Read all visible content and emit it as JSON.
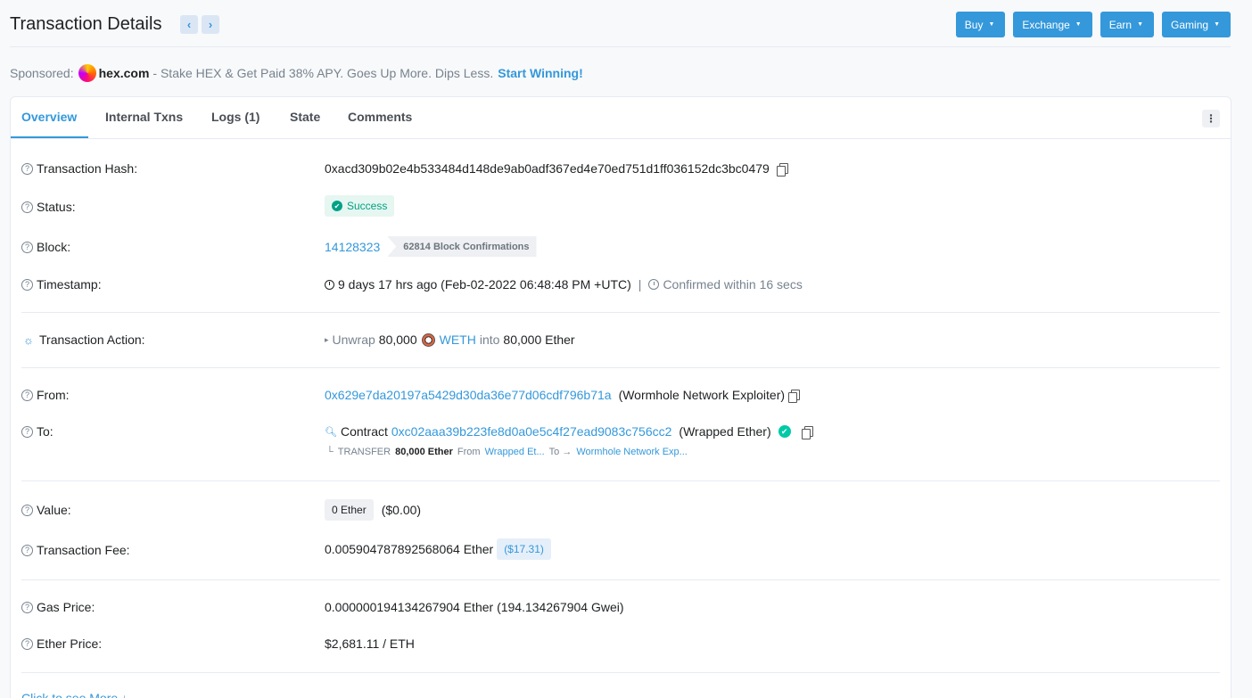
{
  "page": {
    "title": "Transaction Details",
    "prev_arrow": "‹",
    "next_arrow": "›"
  },
  "top_buttons": [
    {
      "label": "Buy"
    },
    {
      "label": "Exchange"
    },
    {
      "label": "Earn"
    },
    {
      "label": "Gaming"
    }
  ],
  "sponsor": {
    "prefix": "Sponsored:",
    "brand": "hex.com",
    "text": "- Stake HEX & Get Paid 38% APY. Goes Up More. Dips Less.",
    "cta": "Start Winning!"
  },
  "tabs": [
    {
      "label": "Overview"
    },
    {
      "label": "Internal Txns"
    },
    {
      "label": "Logs (1)"
    },
    {
      "label": "State"
    },
    {
      "label": "Comments"
    }
  ],
  "rows": {
    "tx_hash": {
      "label": "Transaction Hash:",
      "value": "0xacd309b02e4b533484d148de9ab0adf367ed4e70ed751d1ff036152dc3bc0479"
    },
    "status": {
      "label": "Status:",
      "value": "Success"
    },
    "block": {
      "label": "Block:",
      "value": "14128323",
      "confirmations": "62814 Block Confirmations"
    },
    "timestamp": {
      "label": "Timestamp:",
      "value": "9 days 17 hrs ago (Feb-02-2022 06:48:48 PM +UTC)",
      "divider": "|",
      "confirmed": "Confirmed within 16 secs"
    },
    "action": {
      "label": "Transaction Action:",
      "verb": "Unwrap",
      "amount": "80,000",
      "token": "WETH",
      "into": "into",
      "result": "80,000 Ether"
    },
    "from": {
      "label": "From:",
      "address": "0x629e7da20197a5429d30da36e77d06cdf796b71a",
      "tag": "(Wormhole Network Exploiter)"
    },
    "to": {
      "label": "To:",
      "prefix": "Contract",
      "address": "0xc02aaa39b223fe8d0a0e5c4f27ead9083c756cc2",
      "tag": "(Wrapped Ether)"
    },
    "transfer": {
      "arrow": "└",
      "type": "TRANSFER",
      "amount": "80,000 Ether",
      "from_label": "From",
      "from_value": "Wrapped Et...",
      "to_label": "To →",
      "to_value": "Wormhole Network Exp..."
    },
    "value": {
      "label": "Value:",
      "value": "0 Ether",
      "usd": "($0.00)"
    },
    "fee": {
      "label": "Transaction Fee:",
      "value": "0.005904787892568064 Ether",
      "usd": "($17.31)"
    },
    "gas_price": {
      "label": "Gas Price:",
      "value": "0.000000194134267904 Ether (194.134267904 Gwei)"
    },
    "ether_price": {
      "label": "Ether Price:",
      "value": "$2,681.11 / ETH"
    }
  },
  "click_more": "Click to see More ↓"
}
